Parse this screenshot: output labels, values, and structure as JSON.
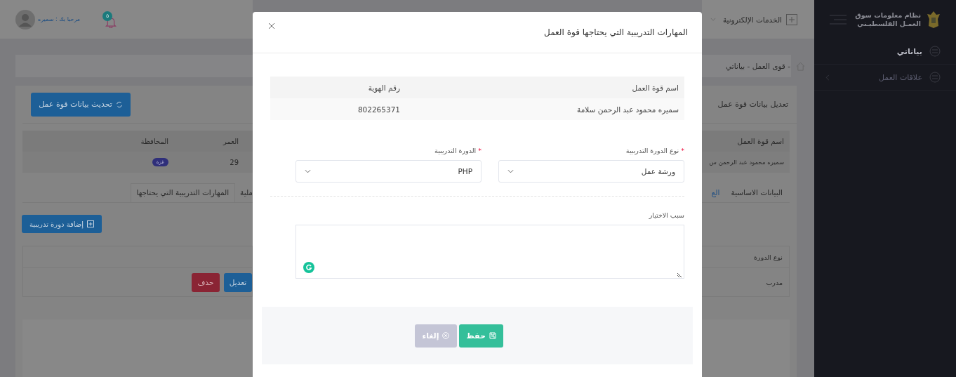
{
  "header": {
    "greeting": "مرحبا بك : سميره",
    "notifications": "٥",
    "services_menu": "الخدمات الإلكترونية"
  },
  "sidebar": {
    "title_lines": [
      "نظام معلومات سوق",
      "العمـل الفلسطيـني"
    ],
    "items": [
      {
        "label": "بياناتي",
        "selected": true,
        "expandable": false
      },
      {
        "label": "علاقات العمل",
        "selected": false,
        "expandable": true
      }
    ]
  },
  "breadcrumb": "- قوى العمل - بياناتي",
  "page": {
    "card_title": "تعديل بيانات قوة عمل",
    "refresh_button": "تحديث بيانات قوة عمل",
    "info_table": {
      "columns": [
        "اسم قوة العمل",
        "العمر",
        "المحافظة"
      ],
      "values": [
        "سميره محمود عبد الرحمن س",
        "29",
        "غزة"
      ]
    },
    "tabs": [
      {
        "label": "البيانات الاساسية",
        "selected": false
      },
      {
        "label": "الع",
        "selected": false
      },
      {
        "label": "ملية",
        "selected": false
      },
      {
        "label": "المهارات التدريبية التي يحتاجها",
        "selected": true
      }
    ],
    "add_button": "إضافة دورة تدريبية",
    "courses_table": {
      "column": "نوع الدورة",
      "course_type": "مدرب",
      "edit_button": "تعديل",
      "delete_button": "حذف"
    }
  },
  "modal": {
    "title": "المهارات التدريبية التي يحتاجها قوة العمل",
    "table": {
      "columns": [
        "اسم قوة العمل",
        "رقم الهوية"
      ],
      "row": [
        "سميره محمود عبد الرحمن سلامة",
        "802265371"
      ]
    },
    "fields": [
      {
        "label": "نوع الدورة التدريبية",
        "required": true,
        "value": "ورشة عمل"
      },
      {
        "label": "الدورة التدريبية",
        "required": true,
        "value": "PHP"
      }
    ],
    "required_mark": "*",
    "reason": {
      "label": "سبب الاختيار"
    },
    "save_button": "حفظ",
    "cancel_button": "إلغاء"
  }
}
